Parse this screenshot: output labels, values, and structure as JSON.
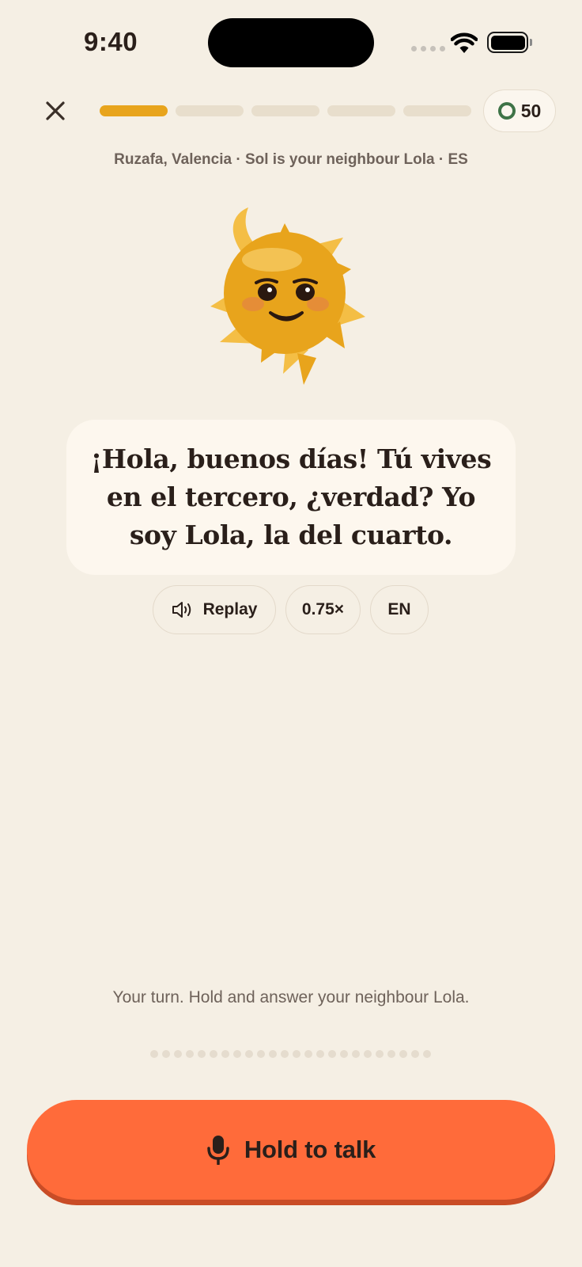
{
  "status_bar": {
    "time": "9:40"
  },
  "header": {
    "close_icon": "close-icon",
    "progress": {
      "total_steps": 5,
      "completed_steps": 1
    },
    "coins": {
      "value": "50",
      "icon": "coin-ring-icon",
      "color": "#3E7347"
    }
  },
  "scene": {
    "location": "Ruzafa, Valencia · Sol is your neighbour Lola · ES"
  },
  "character": {
    "icon": "sun-character-icon"
  },
  "bubble": {
    "text": "¡Hola, buenos días! Tú vives en el tercero, ¿verdad? Yo soy Lola, la del cuarto."
  },
  "controls": {
    "replay_label": "Replay",
    "replay_icon": "speaker-icon",
    "speed_label": "0.75×",
    "lang_label": "EN"
  },
  "prompt": {
    "text": "Your turn. Hold and answer your neighbour Lola."
  },
  "talk_button": {
    "label": "Hold to talk",
    "icon": "microphone-icon",
    "color": "#FF6B3A"
  },
  "colors": {
    "background": "#F5EFE4",
    "accent": "#E8A41C",
    "text": "#2A1F1A"
  }
}
